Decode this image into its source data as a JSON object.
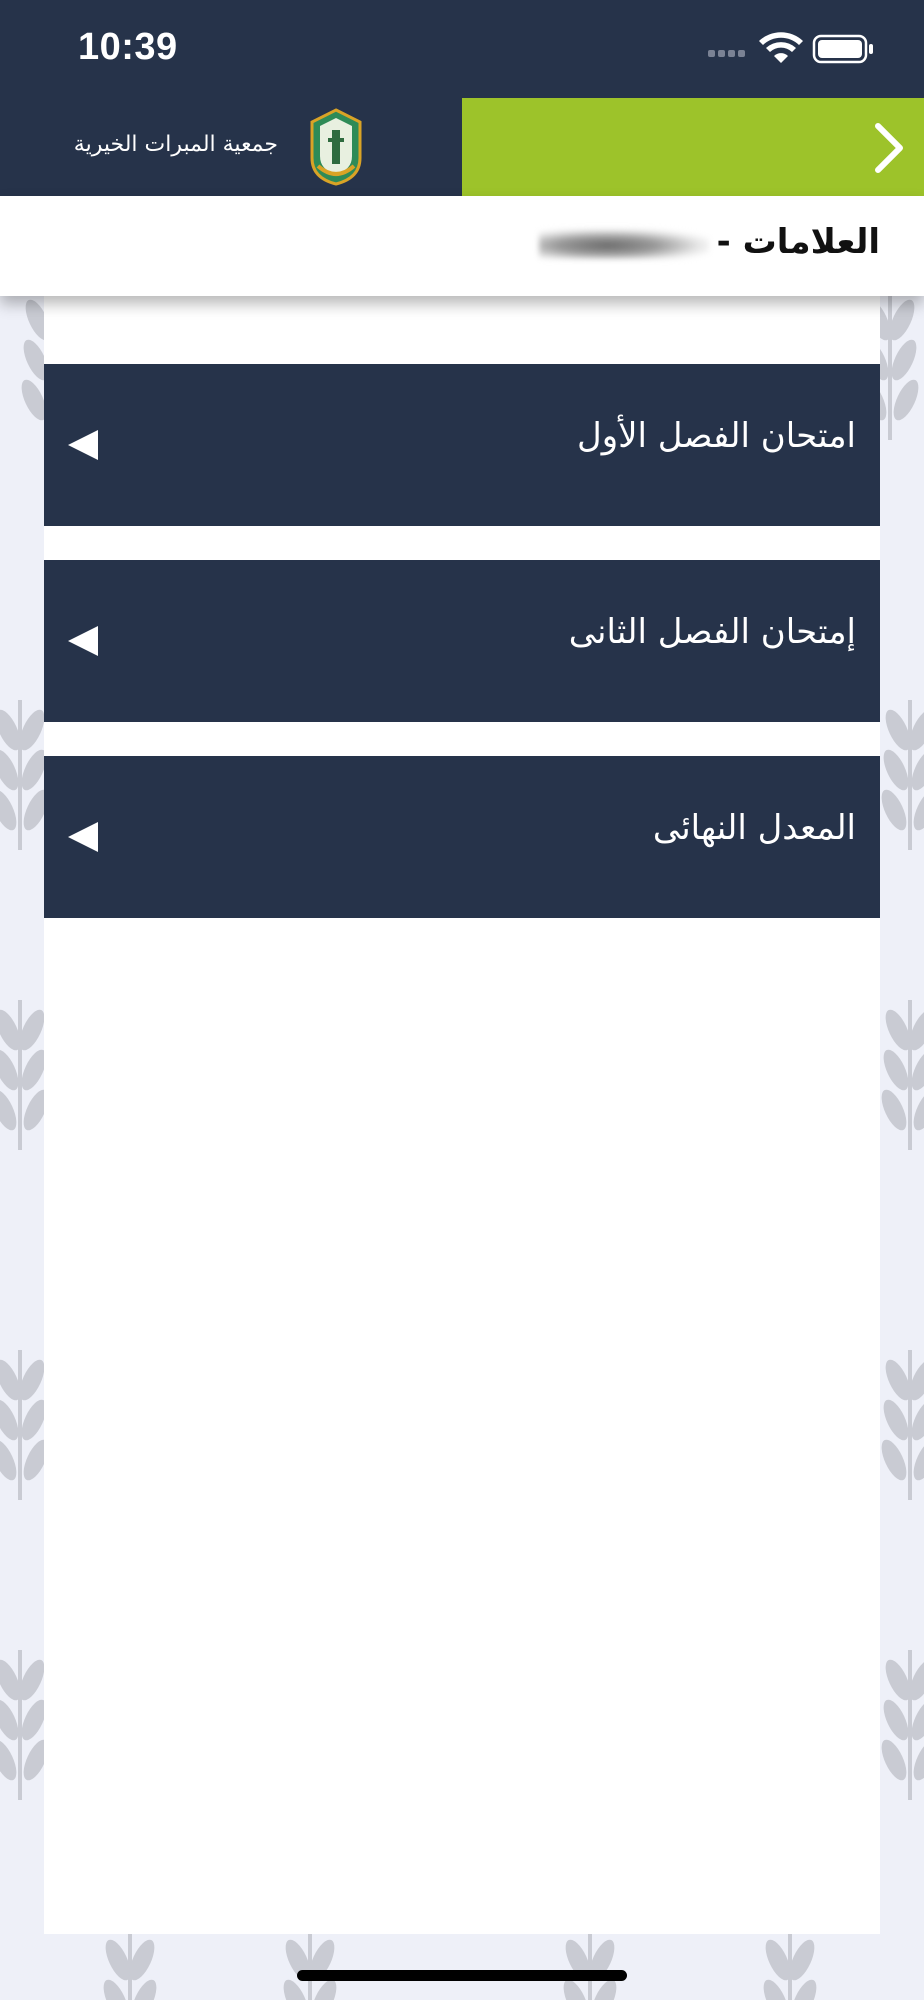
{
  "status_bar": {
    "time": "10:39"
  },
  "header": {
    "org_name": "جمعية المبرات الخيرية",
    "logo_icon": "mabarrat-logo",
    "back_icon": "chevron-right-icon",
    "colors": {
      "dark": "#26334a",
      "accent": "#9dc32a"
    }
  },
  "title_bar": {
    "title": "العلامات -"
  },
  "accordion": {
    "items": [
      {
        "label": "امتحان الفصل الأول",
        "icon": "triangle-left-icon"
      },
      {
        "label": "إمتحان الفصل الثانى",
        "icon": "triangle-left-icon"
      },
      {
        "label": "المعدل النهائى",
        "icon": "triangle-left-icon"
      }
    ]
  }
}
